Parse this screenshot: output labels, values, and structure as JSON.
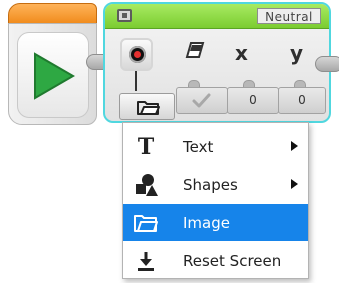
{
  "display_block": {
    "mode": "Neutral",
    "x_label": "x",
    "y_label": "y",
    "x_value": "0",
    "y_value": "0",
    "accent_color": "#7bcc31"
  },
  "menu": {
    "items": [
      {
        "label": "Text",
        "icon": "text-icon",
        "has_submenu": true
      },
      {
        "label": "Shapes",
        "icon": "shapes-icon",
        "has_submenu": true
      },
      {
        "label": "Image",
        "icon": "folder-icon",
        "selected": true
      },
      {
        "label": "Reset Screen",
        "icon": "reset-screen-icon",
        "has_submenu": false
      }
    ],
    "selected_color": "#1684ea"
  }
}
